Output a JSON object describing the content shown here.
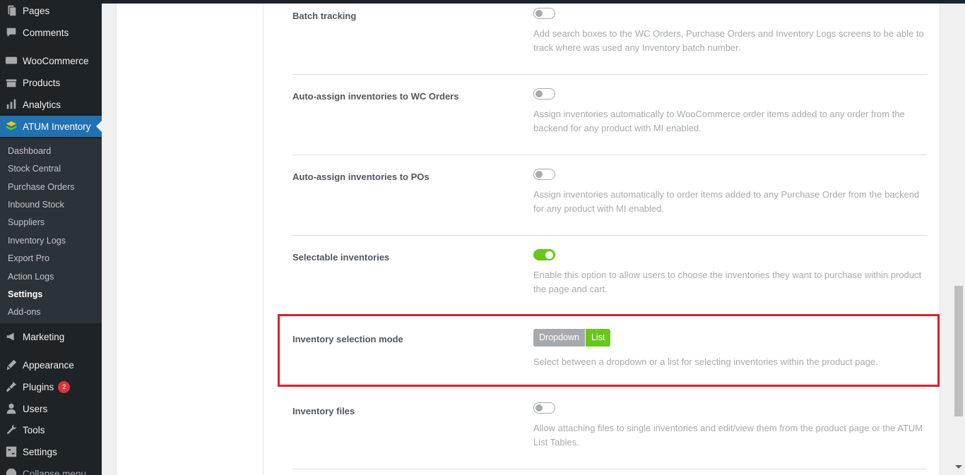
{
  "sidebar": {
    "menu": [
      {
        "label": "Pages",
        "icon": "pages-icon"
      },
      {
        "label": "Comments",
        "icon": "comments-icon"
      },
      {
        "label": "WooCommerce",
        "icon": "woocommerce-icon"
      },
      {
        "label": "Products",
        "icon": "products-icon"
      },
      {
        "label": "Analytics",
        "icon": "analytics-icon"
      },
      {
        "label": "ATUM Inventory",
        "icon": "atum-icon"
      },
      {
        "label": "Marketing",
        "icon": "marketing-icon"
      },
      {
        "label": "Appearance",
        "icon": "appearance-icon"
      },
      {
        "label": "Plugins",
        "icon": "plugins-icon",
        "badge": "2"
      },
      {
        "label": "Users",
        "icon": "users-icon"
      },
      {
        "label": "Tools",
        "icon": "tools-icon"
      },
      {
        "label": "Settings",
        "icon": "settings-icon"
      }
    ],
    "submenu": [
      "Dashboard",
      "Stock Central",
      "Purchase Orders",
      "Inbound Stock",
      "Suppliers",
      "Inventory Logs",
      "Export Pro",
      "Action Logs",
      "Settings",
      "Add-ons"
    ],
    "collapse_label": "Collapse menu"
  },
  "settings": {
    "batch_tracking": {
      "label": "Batch tracking",
      "desc": "Add search boxes to the WC Orders, Purchase Orders and Inventory Logs screens to be able to track where was used any Inventory batch number."
    },
    "auto_assign_wc": {
      "label": "Auto-assign inventories to WC Orders",
      "desc": "Assign inventories automatically to WooCommerce order items added to any order from the backend for any product with MI enabled."
    },
    "auto_assign_po": {
      "label": "Auto-assign inventories to POs",
      "desc": "Assign inventories automatically to order items added to any Purchase Order from the backend for any product with MI enabled."
    },
    "selectable": {
      "label": "Selectable inventories",
      "desc": "Enable this option to allow users to choose the inventories they want to purchase within product the page and cart."
    },
    "selection_mode": {
      "label": "Inventory selection mode",
      "option_dropdown": "Dropdown",
      "option_list": "List",
      "desc": "Select between a dropdown or a list for selecting inventories within the product page."
    },
    "files": {
      "label": "Inventory files",
      "desc": "Allow attaching files to single inventories and edit/view them from the product page or the ATUM List Tables."
    }
  },
  "colors": {
    "sidebar_bg": "#1d2327",
    "active_blue": "#2271b1",
    "toggle_on": "#69c61d",
    "highlight_red": "#d9202d"
  }
}
